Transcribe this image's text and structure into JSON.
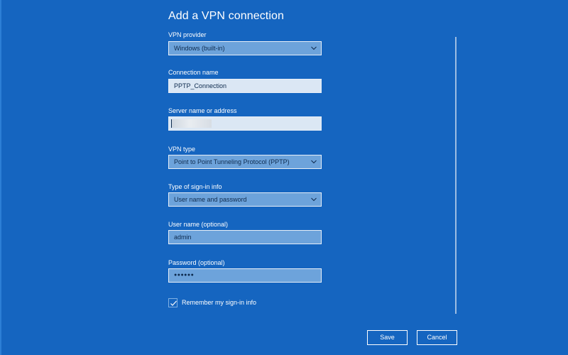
{
  "dialog": {
    "title": "Add a VPN connection"
  },
  "fields": {
    "vpn_provider": {
      "label": "VPN provider",
      "value": "Windows (built-in)"
    },
    "connection_name": {
      "label": "Connection name",
      "value": "PPTP_Connection"
    },
    "server": {
      "label": "Server name or address",
      "value": ""
    },
    "vpn_type": {
      "label": "VPN type",
      "value": "Point to Point Tunneling Protocol (PPTP)"
    },
    "signin_type": {
      "label": "Type of sign-in info",
      "value": "User name and password"
    },
    "username": {
      "label": "User name (optional)",
      "value": "admin"
    },
    "password": {
      "label": "Password (optional)",
      "value": "●●●●●●"
    }
  },
  "remember": {
    "label": "Remember my sign-in info",
    "checked": true
  },
  "buttons": {
    "save_label": "Save",
    "cancel_label": "Cancel"
  },
  "icons": {
    "dropdown": "chevron-down-icon",
    "check": "checkmark-icon"
  },
  "colors": {
    "background": "#1565c0",
    "field_select": "#6da3db",
    "field_text": "#dbe7f4",
    "text_dark": "#0d2a4d"
  }
}
